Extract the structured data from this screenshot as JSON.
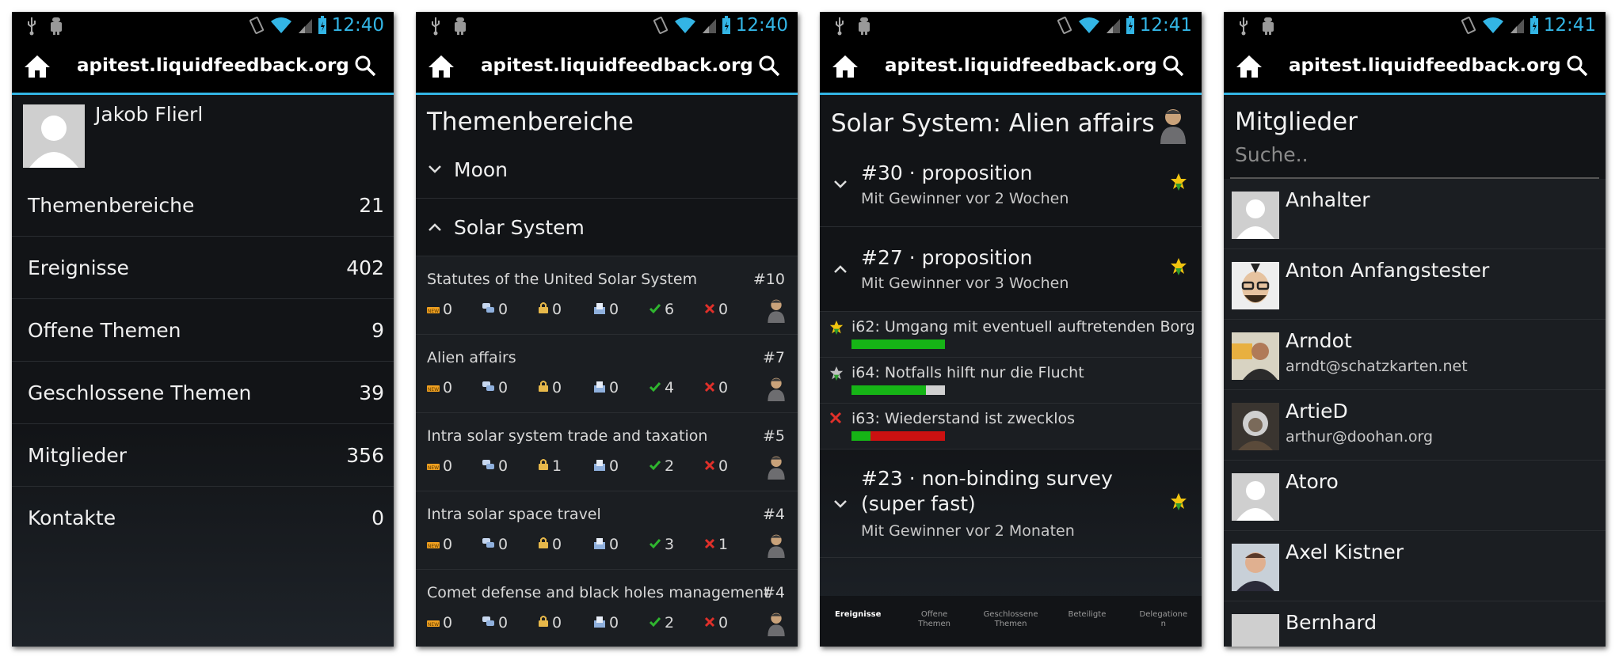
{
  "status": {
    "time1": "12:40",
    "time2": "12:40",
    "time3": "12:41",
    "time4": "12:41"
  },
  "app": {
    "title": "apitest.liquidfeedback.org"
  },
  "screen1": {
    "user_name": "Jakob Flierl",
    "menu": [
      {
        "label": "Themenbereiche",
        "count": "21"
      },
      {
        "label": "Ereignisse",
        "count": "402"
      },
      {
        "label": "Offene Themen",
        "count": "9"
      },
      {
        "label": "Geschlossene Themen",
        "count": "39"
      },
      {
        "label": "Mitglieder",
        "count": "356"
      },
      {
        "label": "Kontakte",
        "count": "0"
      }
    ]
  },
  "screen2": {
    "heading": "Themenbereiche",
    "areas": [
      {
        "label": "Moon",
        "expanded": false
      },
      {
        "label": "Solar System",
        "expanded": true
      }
    ],
    "issues": [
      {
        "title": "Statutes of the United Solar System",
        "num": "#10",
        "stats": [
          "0",
          "0",
          "0",
          "0",
          "6",
          "0"
        ]
      },
      {
        "title": "Alien affairs",
        "num": "#7",
        "stats": [
          "0",
          "0",
          "0",
          "0",
          "4",
          "0"
        ]
      },
      {
        "title": "Intra solar system trade and taxation",
        "num": "#5",
        "stats": [
          "0",
          "0",
          "1",
          "0",
          "2",
          "0"
        ]
      },
      {
        "title": "Intra solar space travel",
        "num": "#4",
        "stats": [
          "0",
          "0",
          "0",
          "0",
          "3",
          "1"
        ]
      },
      {
        "title": "Comet defense and black holes management",
        "num": "#4",
        "stats": [
          "0",
          "0",
          "0",
          "0",
          "2",
          "0"
        ]
      }
    ]
  },
  "screen3": {
    "heading": "Solar System: Alien affairs",
    "props": [
      {
        "title": "#30 · proposition",
        "sub": "Mit Gewinner vor 2 Wochen"
      },
      {
        "title": "#27 · proposition",
        "sub": "Mit Gewinner vor 3 Wochen"
      },
      {
        "title": "#23 · non-binding survey",
        "title2": "(super fast)",
        "sub": "Mit Gewinner vor 2 Monaten"
      }
    ],
    "initiatives": [
      {
        "title": "i62: Umgang mit eventuell auftretenden Borg",
        "approval": 1.0,
        "reject": 0.0
      },
      {
        "title": "i64: Notfalls hilft nur die Flucht",
        "approval": 0.8,
        "reject": 0.0
      },
      {
        "title": "i63: Wiederstand ist zwecklos",
        "approval": 0.2,
        "reject": 0.8
      }
    ],
    "tabs": [
      {
        "line1": "Ereignisse",
        "line2": ""
      },
      {
        "line1": "Offene",
        "line2": "Themen"
      },
      {
        "line1": "Geschlossene",
        "line2": "Themen"
      },
      {
        "line1": "Beteiligte",
        "line2": ""
      },
      {
        "line1": "Delegatione",
        "line2": "n"
      }
    ]
  },
  "screen4": {
    "heading": "Mitglieder",
    "search_placeholder": "Suche..",
    "members": [
      {
        "name": "Anhalter",
        "email": ""
      },
      {
        "name": "Anton Anfangstester",
        "email": ""
      },
      {
        "name": "Arndot",
        "email": "arndt@schatzkarten.net"
      },
      {
        "name": "ArtieD",
        "email": "arthur@doohan.org"
      },
      {
        "name": "Atoro",
        "email": ""
      },
      {
        "name": "Axel Kistner",
        "email": ""
      },
      {
        "name": "Bernhard",
        "email": ""
      }
    ]
  },
  "colors": {
    "accent": "#33b5e5",
    "approve": "#16b416",
    "reject": "#cc1111",
    "neutral": "#d0d0d0"
  }
}
